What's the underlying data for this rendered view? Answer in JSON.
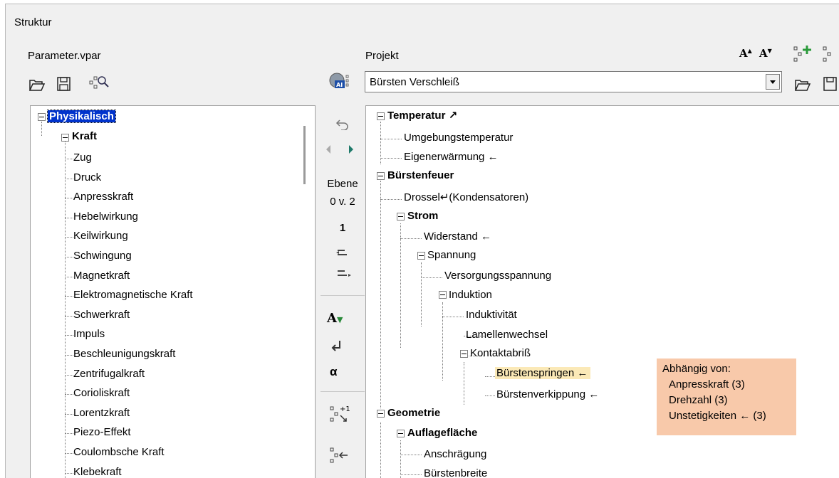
{
  "window": {
    "title": "Struktur"
  },
  "left_panel": {
    "label": "Parameter.vpar",
    "toolbar": [
      "open-folder-icon",
      "save-icon",
      "search-tree-icon"
    ],
    "tree": {
      "root": "Physikalisch",
      "group": "Kraft",
      "items": [
        "Zug",
        "Druck",
        "Anpresskraft",
        "Hebelwirkung",
        "Keilwirkung",
        "Schwingung",
        "Magnetkraft",
        "Elektromagnetische Kraft",
        "Schwerkraft",
        "Impuls",
        "Beschleunigungskraft",
        "Zentrifugalkraft",
        "Corioliskraft",
        "Lorentzkraft",
        "Piezo-Effekt",
        "Coulombsche Kraft",
        "Klebekraft"
      ]
    }
  },
  "middle_bar": {
    "ebene_label": "Ebene",
    "ebene_value": "0 v. 2",
    "level_number": "1",
    "alpha": "α"
  },
  "right_panel": {
    "label": "Projekt",
    "combo_value": "Bürsten Verschleiß",
    "font_increase": "A",
    "font_decrease": "A",
    "tree": {
      "n0": "Temperatur",
      "n0_arrow": "↗",
      "n1": "Umgebungstemperatur",
      "n2": "Eigenerwärmung ←",
      "n3": "Bürstenfeuer",
      "n4": "Drossel↵(Kondensatoren)",
      "n5": "Strom",
      "n6": "Widerstand ←",
      "n7": "Spannung",
      "n8": "Versorgungsspannung",
      "n9": "Induktion",
      "n10": "Induktivität",
      "n11": "Lamellenwechsel",
      "n12": "Kontaktabriß",
      "n13": "Bürstenspringen ←",
      "n14": "Bürstenverkippung ←",
      "n15": "Geometrie",
      "n16": "Auflagefläche",
      "n17": "Anschrägung",
      "n18": "Bürstenbreite"
    }
  },
  "tooltip": {
    "title": "Abhängig von:",
    "lines": [
      "Anpresskraft  (3)",
      "Drehzahl  (3)",
      "Unstetigkeiten  ← (3)"
    ]
  },
  "colors": {
    "selection": "#0033cc",
    "highlight": "#fbe9b7",
    "tooltip_bg": "#f8c9aa"
  }
}
